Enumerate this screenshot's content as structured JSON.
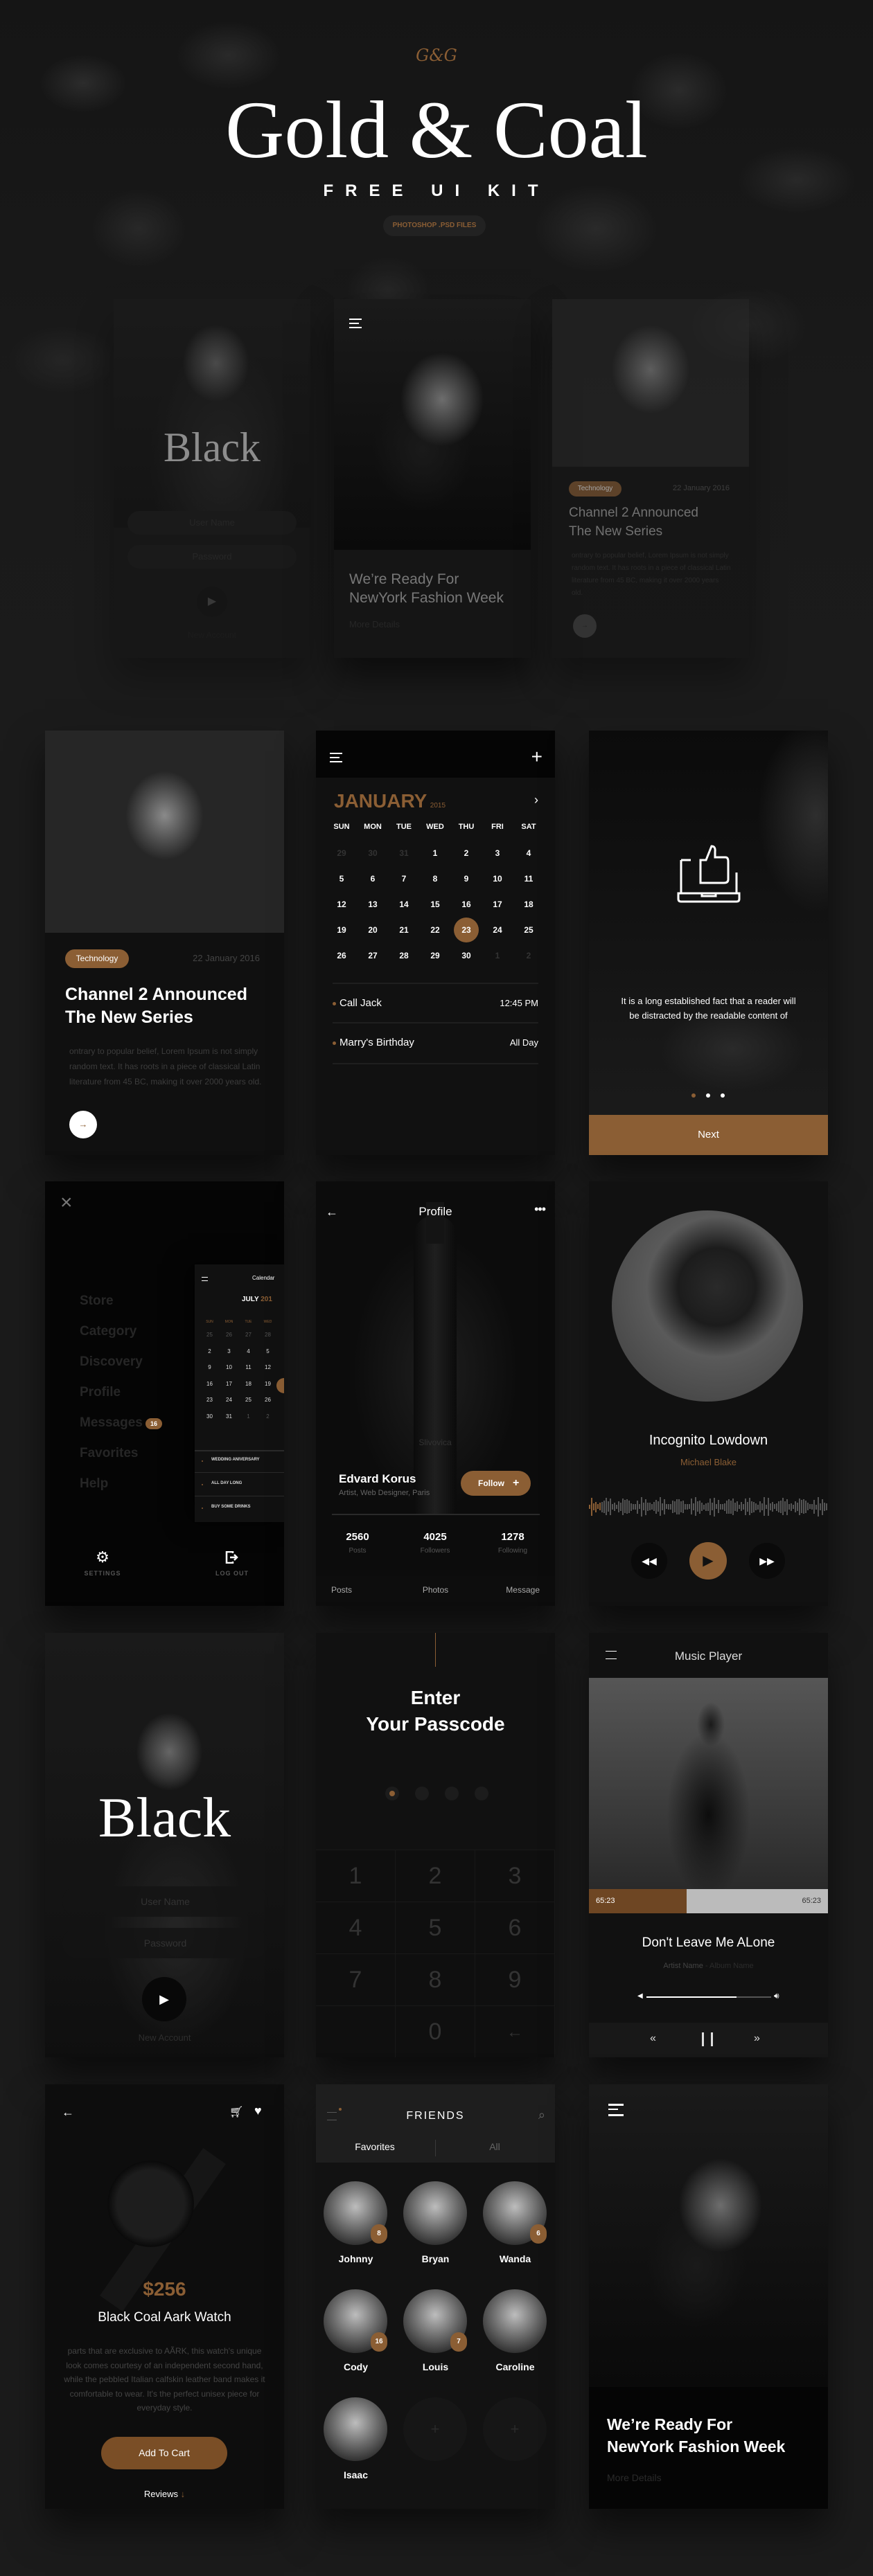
{
  "header": {
    "monogram": "G&G",
    "title": "Gold & Coal",
    "subtitle": "FREE UI KIT",
    "badge": "PHOTOSHOP .PSD FILES"
  },
  "colors": {
    "background": "#1b1b1b",
    "card": "#101010",
    "gold": "#8b5e34"
  },
  "preview": {
    "login": {
      "logo": "Black",
      "username_placeholder": "User Name",
      "password_placeholder": "Password",
      "new_account": "New Account"
    },
    "fashion": {
      "title_line1": "We’re Ready For",
      "title_line2": "NewYork Fashion Week",
      "more": "More Details"
    },
    "article": {
      "tag": "Technology",
      "date": "22 January 2016",
      "title_line1": "Channel 2 Announced",
      "title_line2": "The New Series",
      "body": "ontrary to popular belief, Lorem Ipsum is not simply random text. It has roots in a piece of classical Latin literature from 45 BC, making it over 2000 years old."
    }
  },
  "article": {
    "tag": "Technology",
    "date": "22 January 2016",
    "title_line1": "Channel 2 Announced",
    "title_line2": "The New Series",
    "body": "ontrary to popular belief, Lorem Ipsum is not simply random text. It has roots in a piece of classical Latin literature from 45 BC, making it over 2000 years old.",
    "button_icon": "arrow-right-icon"
  },
  "calendar": {
    "month": "JANUARY",
    "year": "2015",
    "weekdays": [
      "SUN",
      "MON",
      "TUE",
      "WED",
      "THU",
      "FRI",
      "SAT"
    ],
    "weeks": [
      [
        "29",
        "30",
        "31",
        "1",
        "2",
        "3",
        "4"
      ],
      [
        "5",
        "6",
        "7",
        "8",
        "9",
        "10",
        "11"
      ],
      [
        "12",
        "13",
        "14",
        "15",
        "16",
        "17",
        "18"
      ],
      [
        "19",
        "20",
        "21",
        "22",
        "23",
        "24",
        "25"
      ],
      [
        "26",
        "27",
        "28",
        "29",
        "30",
        "1",
        "2"
      ]
    ],
    "outside_month": {
      "leading": 3,
      "trailing": 2
    },
    "selected": "23",
    "events": [
      {
        "title": "Call Jack",
        "time": "12:45 PM"
      },
      {
        "title": "Marry's Birthday",
        "time": "All Day"
      }
    ]
  },
  "onboarding": {
    "text": "It is a long established fact that a reader will be distracted by the readable content of",
    "button": "Next",
    "page": 1,
    "pages": 3,
    "icon": "thumbs-up-laptop-icon"
  },
  "menu": {
    "items": [
      "Store",
      "Category",
      "Discovery",
      "Profile",
      "Messages",
      "Favorites",
      "Help"
    ],
    "messages_badge": "16",
    "settings": "SETTINGS",
    "logout": "LOG OUT",
    "mini_calendar": {
      "title": "Calendar",
      "month": "JULY",
      "year": "201",
      "weekdays": [
        "SUN",
        "MON",
        "TUE",
        "WED"
      ],
      "rows": [
        [
          "25",
          "26",
          "27",
          "28"
        ],
        [
          "2",
          "3",
          "4",
          "5"
        ],
        [
          "9",
          "10",
          "11",
          "12"
        ],
        [
          "16",
          "17",
          "18",
          "19"
        ],
        [
          "23",
          "24",
          "25",
          "26"
        ],
        [
          "30",
          "31",
          "1",
          "2"
        ]
      ],
      "events": [
        "WEDDING ANIVERSARY",
        "ALL DAY LONG",
        "BUY SOME DRINKS"
      ]
    }
  },
  "profile": {
    "title": "Profile",
    "name": "Edvard Korus",
    "subtitle": "Artist, Web Designer, Paris",
    "follow": "Follow",
    "stats": [
      {
        "value": "2560",
        "label": "Posts"
      },
      {
        "value": "4025",
        "label": "Followers"
      },
      {
        "value": "1278",
        "label": "Following"
      }
    ],
    "tabs": [
      "Posts",
      "Photos",
      "Message"
    ],
    "bottle_label": "Slivovica"
  },
  "now_playing": {
    "title": "Incognito Lowdown",
    "artist": "Michael Blake"
  },
  "login": {
    "logo": "Black",
    "username_placeholder": "User Name",
    "password_placeholder": "Password",
    "new_account": "New Account"
  },
  "passcode": {
    "title_line1": "Enter",
    "title_line2": "Your Passcode",
    "keys": [
      "1",
      "2",
      "3",
      "4",
      "5",
      "6",
      "7",
      "8",
      "9",
      "",
      "0",
      "←"
    ],
    "entered": 1,
    "length": 4
  },
  "music_player": {
    "title": "Music Player",
    "elapsed": "65:23",
    "total": "65:23",
    "progress": 0.41,
    "song": "Don't Leave Me ALone",
    "artist": "Artist Name",
    "album": "- Album Name",
    "volume": 0.72
  },
  "product": {
    "price": "$256",
    "name": "Black Coal Aark Watch",
    "description": "parts that are exclusive to AÃRK, this watch's unique look comes courtesy of an independent second hand, while the pebbled Italian calfskin leather band makes it comfortable to wear. It's the perfect unisex piece for everyday style.",
    "button": "Add To Cart",
    "reviews": "Reviews"
  },
  "friends": {
    "title": "FRIENDS",
    "tabs": [
      "Favorites",
      "All"
    ],
    "people": [
      {
        "name": "Johnny",
        "badge": "8"
      },
      {
        "name": "Bryan",
        "badge": ""
      },
      {
        "name": "Wanda",
        "badge": "6"
      },
      {
        "name": "Cody",
        "badge": "16"
      },
      {
        "name": "Louis",
        "badge": "7"
      },
      {
        "name": "Caroline",
        "badge": ""
      },
      {
        "name": "Isaac",
        "badge": ""
      }
    ],
    "empty_slots": 2
  },
  "fashion": {
    "title_line1": "We’re Ready For",
    "title_line2": "NewYork Fashion Week",
    "more": "More Details"
  }
}
